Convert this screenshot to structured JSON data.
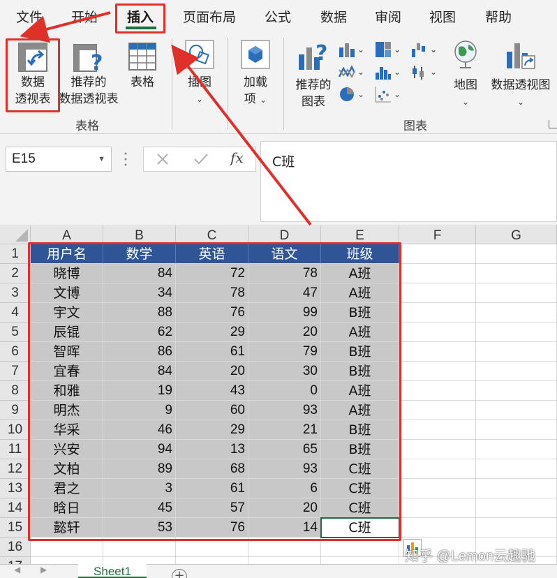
{
  "menu": {
    "items": [
      "文件",
      "开始",
      "插入",
      "页面布局",
      "公式",
      "数据",
      "审阅",
      "视图",
      "帮助"
    ],
    "active": "插入"
  },
  "ribbon": {
    "pivot_table": [
      "数据",
      "透视表"
    ],
    "recommended_pivot": [
      "推荐的",
      "数据透视表"
    ],
    "table": "表格",
    "illustrations": "插图",
    "addins": [
      "加载",
      "项"
    ],
    "recommended_charts": [
      "推荐的",
      "图表"
    ],
    "map": "地图",
    "pivot_chart": "数据透视图",
    "group_tables": "表格",
    "group_charts": "图表"
  },
  "formula_bar": {
    "name_box": "E15",
    "fx": "fx",
    "content": "C班"
  },
  "columns": [
    "A",
    "B",
    "C",
    "D",
    "E",
    "F",
    "G"
  ],
  "table": {
    "headers": [
      "用户名",
      "数学",
      "英语",
      "语文",
      "班级"
    ],
    "rows": [
      [
        "晓博",
        "84",
        "72",
        "78",
        "A班"
      ],
      [
        "文博",
        "34",
        "78",
        "47",
        "A班"
      ],
      [
        "宇文",
        "88",
        "76",
        "99",
        "B班"
      ],
      [
        "辰锟",
        "62",
        "29",
        "20",
        "A班"
      ],
      [
        "智晖",
        "86",
        "61",
        "79",
        "B班"
      ],
      [
        "宜春",
        "84",
        "20",
        "30",
        "B班"
      ],
      [
        "和雅",
        "19",
        "43",
        "0",
        "A班"
      ],
      [
        "明杰",
        "9",
        "60",
        "93",
        "A班"
      ],
      [
        "华采",
        "46",
        "29",
        "21",
        "B班"
      ],
      [
        "兴安",
        "94",
        "13",
        "65",
        "B班"
      ],
      [
        "文柏",
        "89",
        "68",
        "93",
        "C班"
      ],
      [
        "君之",
        "3",
        "61",
        "6",
        "C班"
      ],
      [
        "晗日",
        "45",
        "57",
        "20",
        "C班"
      ],
      [
        "懿轩",
        "53",
        "76",
        "14",
        "C班"
      ]
    ]
  },
  "row_numbers": [
    "1",
    "2",
    "3",
    "4",
    "5",
    "6",
    "7",
    "8",
    "9",
    "10",
    "11",
    "12",
    "13",
    "14",
    "15",
    "16",
    "17"
  ],
  "sheet_tab": "Sheet1",
  "watermark": "知乎 @Lemon云趣驰",
  "colors": {
    "header_fill": "#2f5597",
    "body_fill": "#c8c8c8",
    "accent": "#1d6f42",
    "highlight": "#e0302a"
  }
}
